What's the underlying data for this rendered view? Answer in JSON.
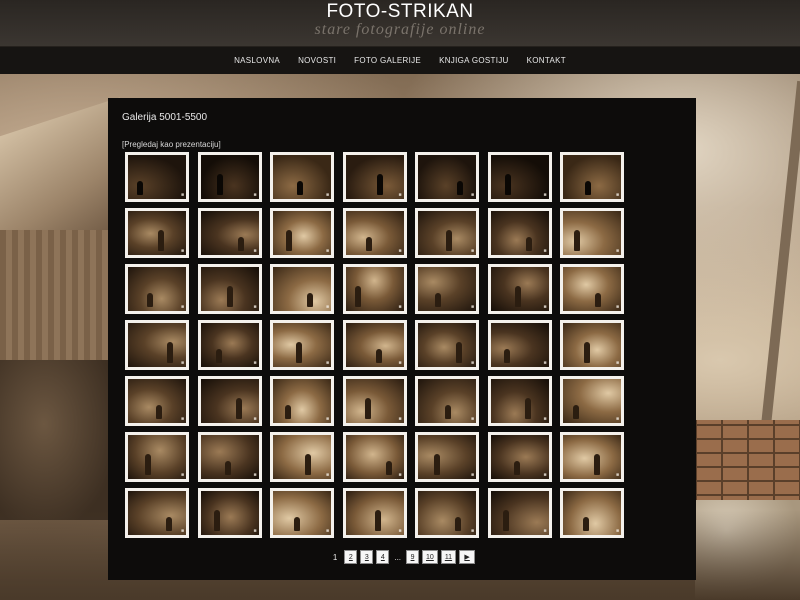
{
  "site": {
    "title": "FOTO-STRIKAN",
    "subtitle": "stare fotografije online"
  },
  "nav": {
    "items": [
      {
        "label": "NASLOVNA"
      },
      {
        "label": "NOVOSTI"
      },
      {
        "label": "FOTO GALERIJE"
      },
      {
        "label": "KNJIGA GOSTIJU"
      },
      {
        "label": "KONTAKT"
      }
    ]
  },
  "gallery": {
    "title": "Galerija 5001-5500",
    "slideshow_link": "[Pregledaj kao prezentaciju]",
    "thumbnail_count": 49,
    "columns": 7,
    "rows": 7
  },
  "pagination": {
    "current": "1",
    "pages": [
      "2",
      "3",
      "4"
    ],
    "ellipsis": "...",
    "end_pages": [
      "9",
      "10",
      "11"
    ],
    "next_label": "▶"
  },
  "colors": {
    "header_bg": "#2f2b27",
    "nav_bg": "#161412",
    "panel_bg": "#0d0c0b",
    "thumb_frame": "#f4f1ec",
    "sepia": "#8a6d4c"
  }
}
